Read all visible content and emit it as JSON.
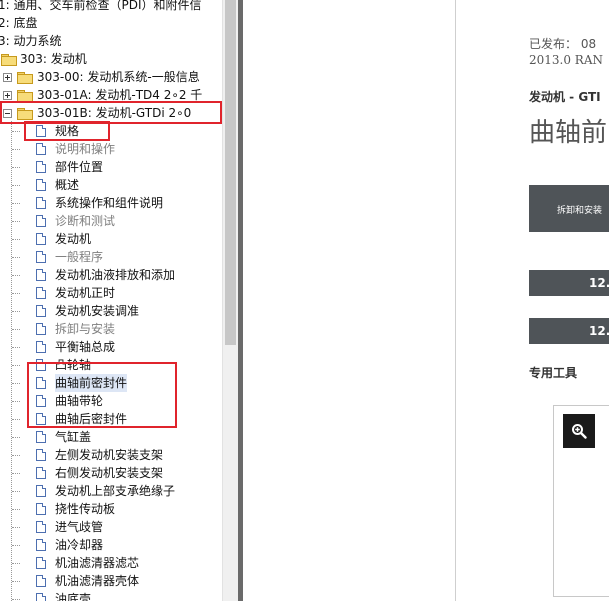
{
  "tree": {
    "rows": [
      {
        "label": "1: 通用、交车前检查（PDI）和附件信",
        "indent": 0,
        "type": "text",
        "y": 0
      },
      {
        "label": "2: 底盘",
        "indent": 0,
        "type": "text",
        "y": 1
      },
      {
        "label": "3: 动力系统",
        "indent": 0,
        "type": "text",
        "y": 2
      },
      {
        "label": "303: 发动机",
        "indent": 0,
        "type": "folder-open",
        "y": 3
      },
      {
        "label": "303-00: 发动机系统-一般信息",
        "indent": 1,
        "type": "folder-plus",
        "y": 4
      },
      {
        "label": "303-01A: 发动机-TD4 2∘2 千",
        "indent": 1,
        "type": "folder-plus",
        "y": 5
      },
      {
        "label": "303-01B: 发动机-GTDi 2∘0",
        "indent": 1,
        "type": "folder-minus",
        "y": 6
      },
      {
        "label": "规格",
        "indent": 2,
        "type": "doc",
        "y": 7
      },
      {
        "label": "说明和操作",
        "indent": 2,
        "type": "doc",
        "y": 8,
        "gray": true
      },
      {
        "label": "部件位置",
        "indent": 2,
        "type": "doc",
        "y": 9
      },
      {
        "label": "概述",
        "indent": 2,
        "type": "doc",
        "y": 10
      },
      {
        "label": "系统操作和组件说明",
        "indent": 2,
        "type": "doc",
        "y": 11
      },
      {
        "label": "诊断和测试",
        "indent": 2,
        "type": "doc",
        "y": 12,
        "gray": true
      },
      {
        "label": "发动机",
        "indent": 2,
        "type": "doc",
        "y": 13
      },
      {
        "label": "一般程序",
        "indent": 2,
        "type": "doc",
        "y": 14,
        "gray": true
      },
      {
        "label": "发动机油液排放和添加",
        "indent": 2,
        "type": "doc",
        "y": 15
      },
      {
        "label": "发动机正时",
        "indent": 2,
        "type": "doc",
        "y": 16
      },
      {
        "label": "发动机安装调准",
        "indent": 2,
        "type": "doc",
        "y": 17
      },
      {
        "label": "拆卸与安装",
        "indent": 2,
        "type": "doc",
        "y": 18,
        "gray": true
      },
      {
        "label": "平衡轴总成",
        "indent": 2,
        "type": "doc",
        "y": 19
      },
      {
        "label": "凸轮轴",
        "indent": 2,
        "type": "doc",
        "y": 20
      },
      {
        "label": "曲轴前密封件",
        "indent": 2,
        "type": "doc",
        "y": 21,
        "selected": true
      },
      {
        "label": "曲轴带轮",
        "indent": 2,
        "type": "doc",
        "y": 22
      },
      {
        "label": "曲轴后密封件",
        "indent": 2,
        "type": "doc",
        "y": 23
      },
      {
        "label": "气缸盖",
        "indent": 2,
        "type": "doc",
        "y": 24
      },
      {
        "label": "左侧发动机安装支架",
        "indent": 2,
        "type": "doc",
        "y": 25
      },
      {
        "label": "右侧发动机安装支架",
        "indent": 2,
        "type": "doc",
        "y": 26
      },
      {
        "label": "发动机上部支承绝缘子",
        "indent": 2,
        "type": "doc",
        "y": 27
      },
      {
        "label": "挠性传动板",
        "indent": 2,
        "type": "doc",
        "y": 28
      },
      {
        "label": "进气歧管",
        "indent": 2,
        "type": "doc",
        "y": 29
      },
      {
        "label": "油冷却器",
        "indent": 2,
        "type": "doc",
        "y": 30
      },
      {
        "label": "机油滤清器滤芯",
        "indent": 2,
        "type": "doc",
        "y": 31
      },
      {
        "label": "机油滤清器壳体",
        "indent": 2,
        "type": "doc",
        "y": 32
      },
      {
        "label": "油底壳",
        "indent": 2,
        "type": "doc",
        "y": 33
      }
    ]
  },
  "doc": {
    "publish_label": "已发布： 08",
    "version": "2013.0 RAN",
    "section": "发动机 - GTI",
    "title": "曲轴前",
    "bar1_text": "拆卸和安装",
    "bar2_text": "12.",
    "bar3_text": "12.",
    "special_tools": "专用工具"
  },
  "icons": {
    "zoom": "magnifier-plus-icon"
  },
  "colors": {
    "highlight_box": "#e0242c",
    "dark_bar": "#4f5458",
    "selection": "#dde6f5"
  }
}
